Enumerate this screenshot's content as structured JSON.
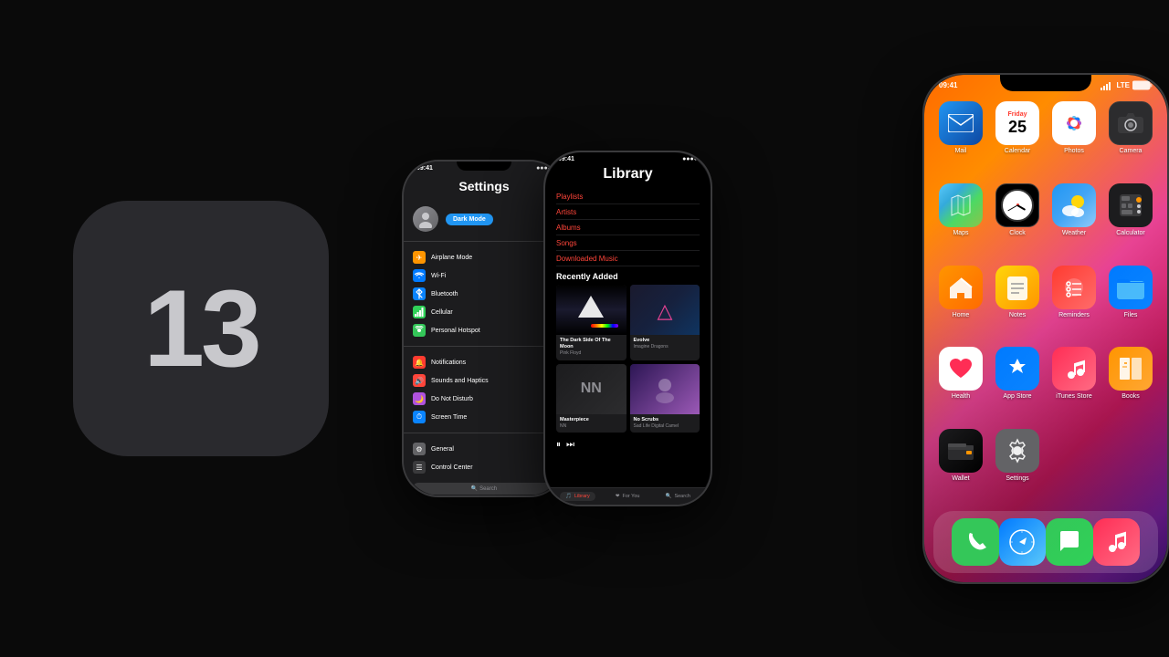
{
  "logo": {
    "number": "13"
  },
  "phone_settings": {
    "status_time": "09:41",
    "title": "Settings",
    "profile_button": "Dark Mode",
    "items": [
      {
        "label": "Airplane Mode",
        "icon_type": "orange",
        "icon_char": "✈"
      },
      {
        "label": "Wi-Fi",
        "icon_type": "blue",
        "icon_char": ""
      },
      {
        "label": "Bluetooth",
        "icon_type": "blue2",
        "icon_char": ""
      },
      {
        "label": "Cellular",
        "icon_type": "green",
        "icon_char": ""
      },
      {
        "label": "Personal Hotspot",
        "icon_type": "green2",
        "icon_char": ""
      }
    ],
    "items2": [
      {
        "label": "Notifications",
        "icon_type": "red",
        "icon_char": ""
      },
      {
        "label": "Sounds and Haptics",
        "icon_type": "red2",
        "icon_char": ""
      },
      {
        "label": "Do Not Disturb",
        "icon_type": "purple",
        "icon_char": ""
      },
      {
        "label": "Screen Time",
        "icon_type": "blue2",
        "icon_char": ""
      }
    ],
    "items3": [
      {
        "label": "General",
        "icon_type": "gray",
        "icon_char": ""
      },
      {
        "label": "Control Center",
        "icon_type": "dark",
        "icon_char": ""
      }
    ],
    "search_placeholder": "Search"
  },
  "phone_music": {
    "status_time": "09:41",
    "title": "Library",
    "nav_items": [
      {
        "label": "Playlists",
        "active": true
      },
      {
        "label": "Artists",
        "active": false
      },
      {
        "label": "Albums",
        "active": false
      },
      {
        "label": "Songs",
        "active": false
      },
      {
        "label": "Downloaded Music",
        "active": false
      }
    ],
    "recently_added": "Recently Added",
    "albums": [
      {
        "title": "The Dark Side Of The Moon",
        "artist": "Pink Floyd"
      },
      {
        "title": "Evolve",
        "artist": "Imagine Dragons"
      },
      {
        "title": "Masterpiece",
        "artist": "NN"
      },
      {
        "title": "No Scrubs",
        "artist": "Sad Life Digital Camel"
      }
    ],
    "tabs": [
      {
        "label": "Library",
        "active": true
      },
      {
        "label": "For You",
        "active": false
      },
      {
        "label": "Search",
        "active": false
      }
    ]
  },
  "phone_home": {
    "status_time": "09:41",
    "status_signal": "LTE",
    "status_battery": "100",
    "apps": [
      {
        "label": "Mail",
        "icon_class": "app-mail",
        "char": "✉"
      },
      {
        "label": "Calendar",
        "icon_class": "app-calendar",
        "char": "📅",
        "day": "Friday",
        "num": "25"
      },
      {
        "label": "Photos",
        "icon_class": "app-photos",
        "char": ""
      },
      {
        "label": "Camera",
        "icon_class": "app-camera",
        "char": "📷"
      },
      {
        "label": "Maps",
        "icon_class": "app-maps",
        "char": "🗺"
      },
      {
        "label": "Clock",
        "icon_class": "app-clock",
        "char": "🕐"
      },
      {
        "label": "Weather",
        "icon_class": "app-weather",
        "char": "⛅"
      },
      {
        "label": "Calculator",
        "icon_class": "app-calculator",
        "char": "🔢"
      },
      {
        "label": "Home",
        "icon_class": "app-home",
        "char": "🏠"
      },
      {
        "label": "Notes",
        "icon_class": "app-notes",
        "char": "📝"
      },
      {
        "label": "Reminders",
        "icon_class": "app-reminders",
        "char": "☑"
      },
      {
        "label": "Files",
        "icon_class": "app-files",
        "char": "📁"
      },
      {
        "label": "Health",
        "icon_class": "app-health",
        "char": "❤"
      },
      {
        "label": "App Store",
        "icon_class": "app-appstore",
        "char": "🅐"
      },
      {
        "label": "iTunes Store",
        "icon_class": "app-itunes",
        "char": "🎵"
      },
      {
        "label": "Books",
        "icon_class": "app-books",
        "char": "📚"
      },
      {
        "label": "Wallet",
        "icon_class": "app-wallet",
        "char": "💳"
      },
      {
        "label": "Settings",
        "icon_class": "app-settings",
        "char": "⚙"
      }
    ],
    "dock_apps": [
      {
        "label": "Phone",
        "icon_class": "dock-phone",
        "char": "📞"
      },
      {
        "label": "Safari",
        "icon_class": "dock-safari",
        "char": "🧭"
      },
      {
        "label": "Messages",
        "icon_class": "dock-messages",
        "char": "💬"
      },
      {
        "label": "Music",
        "icon_class": "dock-music",
        "char": "🎵"
      }
    ]
  }
}
